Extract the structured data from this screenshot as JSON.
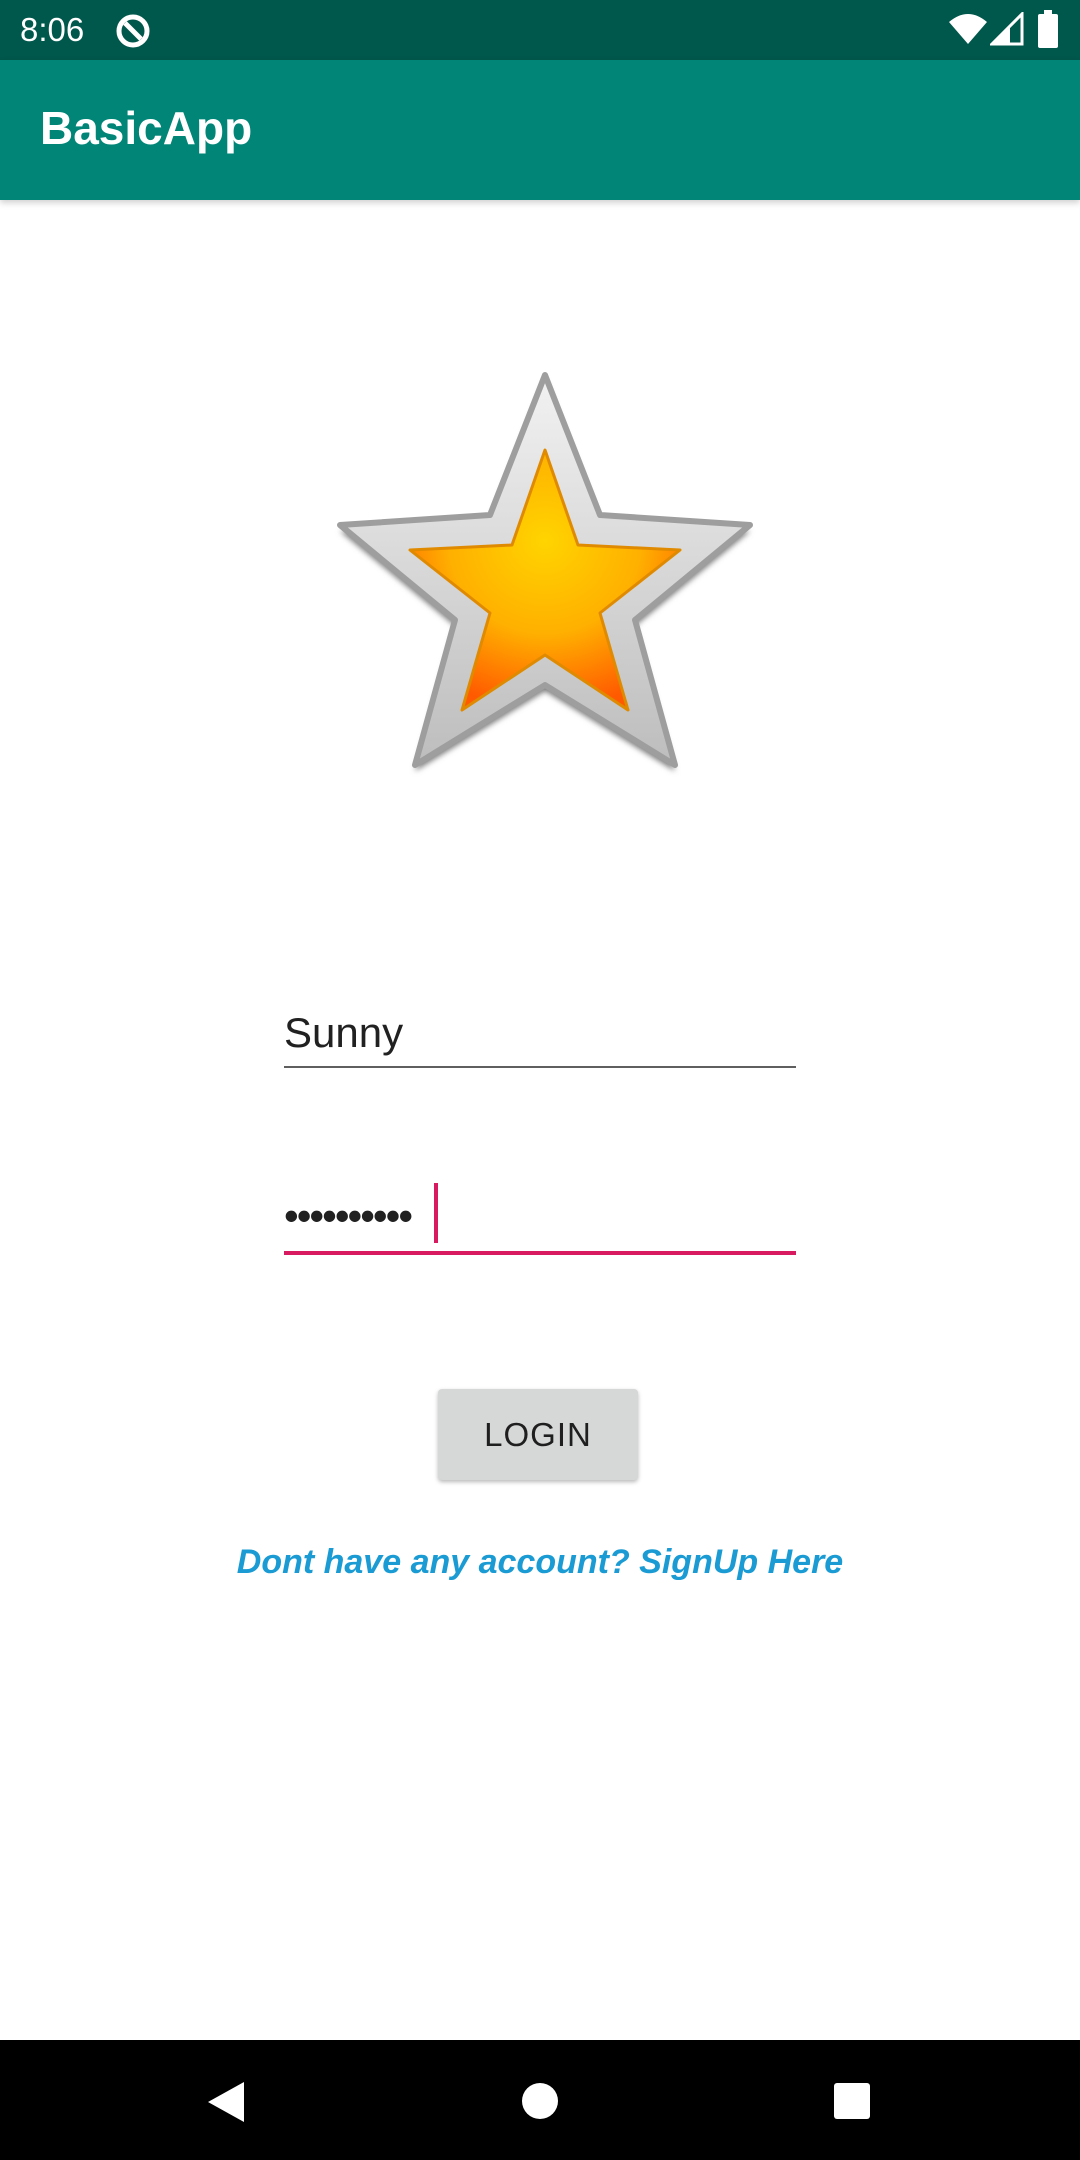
{
  "status_bar": {
    "time": "8:06",
    "app_icon": "data-saver-icon",
    "wifi_icon": "wifi-icon",
    "signal_icon": "cell-signal-icon",
    "battery_icon": "battery-icon"
  },
  "app_bar": {
    "title": "BasicApp",
    "background_color": "#008577",
    "status_color": "#00574b"
  },
  "logo": {
    "icon": "star-icon"
  },
  "form": {
    "username_value": "Sunny",
    "password_value": "••••••••••",
    "accent_color": "#d81b60",
    "login_label": "LOGIN",
    "signup_text": "Dont have any account? SignUp Here",
    "link_color": "#1a9bd3"
  },
  "nav_bar": {
    "back_icon": "back-triangle-icon",
    "home_icon": "home-circle-icon",
    "recents_icon": "recents-square-icon"
  }
}
